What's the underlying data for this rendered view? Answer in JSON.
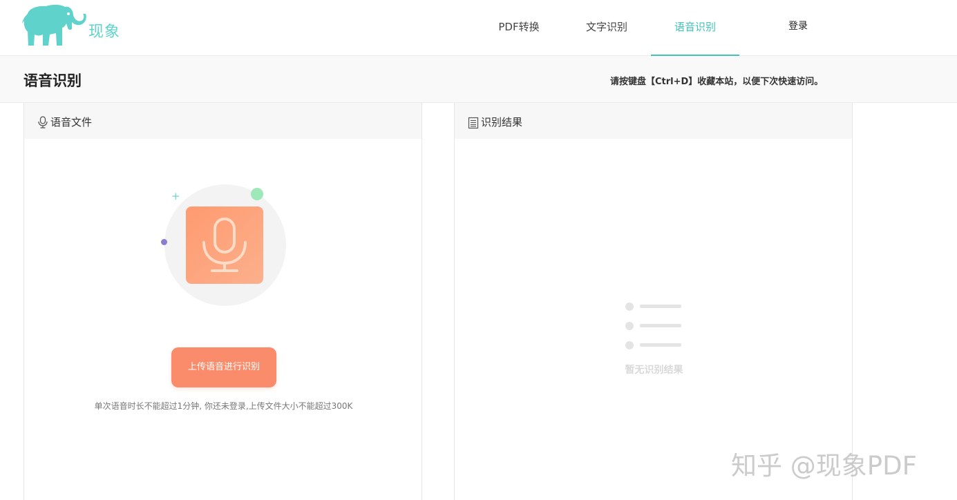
{
  "brand": {
    "name": "现象",
    "color": "#5fd3cb"
  },
  "nav": {
    "items": [
      {
        "label": "PDF转换",
        "active": false
      },
      {
        "label": "文字识别",
        "active": false
      },
      {
        "label": "语音识别",
        "active": true
      }
    ],
    "login_label": "登录",
    "accent": "#3fc4bb"
  },
  "subbar": {
    "title": "语音识别",
    "tip": "请按键盘【Ctrl+D】收藏本站，以便下次快速访问。"
  },
  "left_panel": {
    "header_icon": "microphone-icon",
    "header_label": "语音文件",
    "upload_button_label": "上传语音进行识别",
    "upload_note": "单次语音时长不能超过1分钟, 你还未登录,上传文件大小不能超过300K",
    "button_color": "#fb8c6b"
  },
  "right_panel": {
    "header_icon": "document-icon",
    "header_label": "识别结果",
    "empty_icon": "empty-list-icon",
    "empty_text": "暂无识别结果"
  },
  "watermark": "知乎 @现象PDF"
}
